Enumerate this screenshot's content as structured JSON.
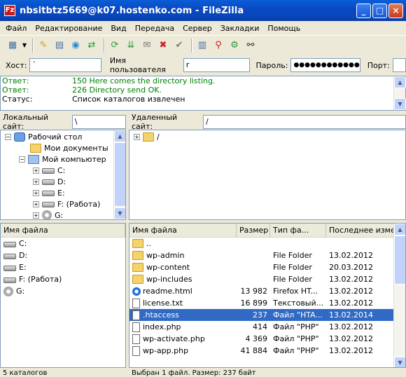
{
  "window": {
    "title": "nbsitbtz5669@k07.hostenko.com - FileZilla",
    "app_icon": "Fz"
  },
  "menu": [
    "Файл",
    "Редактирование",
    "Вид",
    "Передача",
    "Сервер",
    "Закладки",
    "Помощь"
  ],
  "quickconnect": {
    "host_label": "Хост:",
    "host_value": "`",
    "user_label": "Имя пользователя",
    "user_value": "r",
    "pass_label": "Пароль:",
    "pass_value": "●●●●●●●●●●●●",
    "port_label": "Порт:",
    "port_value": ""
  },
  "log": [
    {
      "label": "Ответ:",
      "message": "150 Here comes the directory listing.",
      "type": "resp"
    },
    {
      "label": "Ответ:",
      "message": "226 Directory send OK.",
      "type": "resp"
    },
    {
      "label": "Статус:",
      "message": "Список каталогов извлечен",
      "type": "status"
    }
  ],
  "local": {
    "site_label": "Локальный сайт:",
    "site_path": "\\",
    "tree": {
      "desktop": "Рабочий стол",
      "docs": "Мои документы",
      "computer": "Мой компьютер",
      "drives": [
        "C:",
        "D:",
        "E:",
        "F: (Работа)",
        "G:"
      ]
    },
    "header": {
      "name": "Имя файла"
    },
    "files": [
      "C:",
      "D:",
      "E:",
      "F: (Работа)",
      "G:"
    ],
    "status": "5 каталогов"
  },
  "remote": {
    "site_label": "Удаленный сайт:",
    "site_path": "/",
    "tree_root": "/",
    "header": {
      "name": "Имя файла",
      "size": "Размер",
      "type": "Тип фа...",
      "modified": "Последнее измене"
    },
    "files": [
      {
        "name": "..",
        "size": "",
        "type": "",
        "modified": "",
        "kind": "folder"
      },
      {
        "name": "wp-admin",
        "size": "",
        "type": "File Folder",
        "modified": "13.02.2012",
        "kind": "folder"
      },
      {
        "name": "wp-content",
        "size": "",
        "type": "File Folder",
        "modified": "20.03.2012",
        "kind": "folder"
      },
      {
        "name": "wp-includes",
        "size": "",
        "type": "File Folder",
        "modified": "13.02.2012",
        "kind": "folder"
      },
      {
        "name": "readme.html",
        "size": "13 982",
        "type": "Firefox HT...",
        "modified": "13.02.2012",
        "kind": "html"
      },
      {
        "name": "license.txt",
        "size": "16 899",
        "type": "Текстовый...",
        "modified": "13.02.2012",
        "kind": "file"
      },
      {
        "name": ".htaccess",
        "size": "237",
        "type": "Файл \"HTA...",
        "modified": "13.02.2014",
        "kind": "file",
        "selected": true
      },
      {
        "name": "index.php",
        "size": "414",
        "type": "Файл \"PHP\"",
        "modified": "13.02.2012",
        "kind": "file"
      },
      {
        "name": "wp-activate.php",
        "size": "4 369",
        "type": "Файл \"PHP\"",
        "modified": "13.02.2012",
        "kind": "file"
      },
      {
        "name": "wp-app.php",
        "size": "41 884",
        "type": "Файл \"PHP\"",
        "modified": "13.02.2012",
        "kind": "file"
      }
    ],
    "status": "Выбран 1 файл. Размер: 237 байт"
  },
  "colors": {
    "title_bar": "#0a49c4",
    "selection": "#316ac5",
    "log_response": "#008000",
    "folder": "#f5d36b"
  }
}
